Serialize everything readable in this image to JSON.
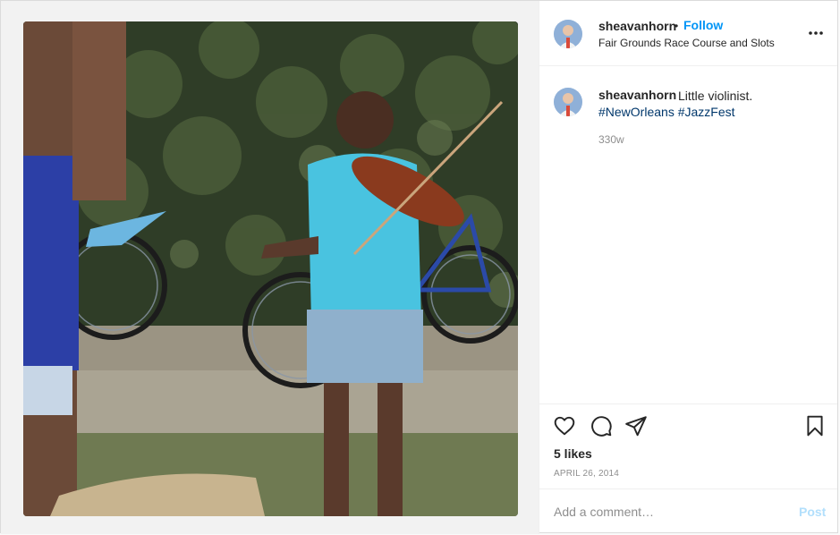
{
  "post": {
    "photo": {
      "icon": "post-photo-violinist"
    },
    "header": {
      "username": "sheavanhorn",
      "separator": "•",
      "follow_label": "Follow",
      "location": "Fair Grounds Race Course and Slots",
      "more_icon": "more-options-icon"
    },
    "caption": {
      "username": "sheavanhorn",
      "text": "Little violinist.",
      "hashtags": [
        "#NewOrleans",
        "#JazzFest"
      ],
      "time": "330w"
    },
    "actions": {
      "icons": [
        "heart-icon",
        "comment-icon",
        "share-icon",
        "save-icon"
      ]
    },
    "likes": "5 likes",
    "date": "APRIL 26, 2014",
    "comment": {
      "placeholder": "Add a comment…",
      "post_label": "Post"
    },
    "colors": {
      "accent": "#0095f6",
      "hashtag": "#00376b",
      "muted": "#8e8e8e",
      "post_disabled": "#b2dffc",
      "border": "#efefef"
    }
  }
}
